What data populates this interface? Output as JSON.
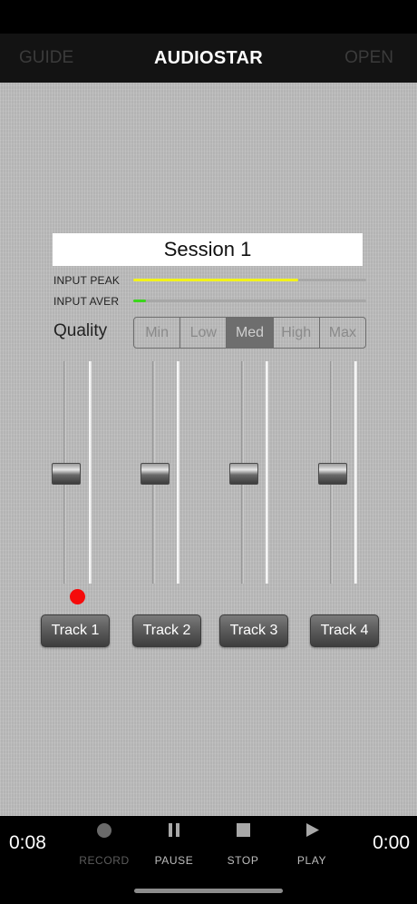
{
  "nav": {
    "left": "GUIDE",
    "title": "AUDIOSTAR",
    "right": "OPEN"
  },
  "session": {
    "name": "Session 1"
  },
  "meters": [
    {
      "label": "INPUT PEAK",
      "level": 0.71,
      "color": "#f2f21a"
    },
    {
      "label": "INPUT AVER",
      "level": 0.055,
      "color": "#3bd61c"
    }
  ],
  "quality": {
    "label": "Quality",
    "options": [
      "Min",
      "Low",
      "Med",
      "High",
      "Max"
    ],
    "selected": "Med"
  },
  "tracks": [
    {
      "label": "Track 1",
      "recording": true
    },
    {
      "label": "Track 2",
      "recording": false
    },
    {
      "label": "Track 3",
      "recording": false
    },
    {
      "label": "Track 4",
      "recording": false
    }
  ],
  "transport": {
    "elapsed": "0:08",
    "remaining": "0:00",
    "controls": [
      {
        "label": "RECORD",
        "icon": "record-icon",
        "enabled": false
      },
      {
        "label": "PAUSE",
        "icon": "pause-icon",
        "enabled": true
      },
      {
        "label": "STOP",
        "icon": "stop-icon",
        "enabled": true
      },
      {
        "label": "PLAY",
        "icon": "play-icon",
        "enabled": true
      }
    ]
  },
  "colors": {
    "record_dot": "#f50b0b",
    "background": "#bdbdbd"
  }
}
